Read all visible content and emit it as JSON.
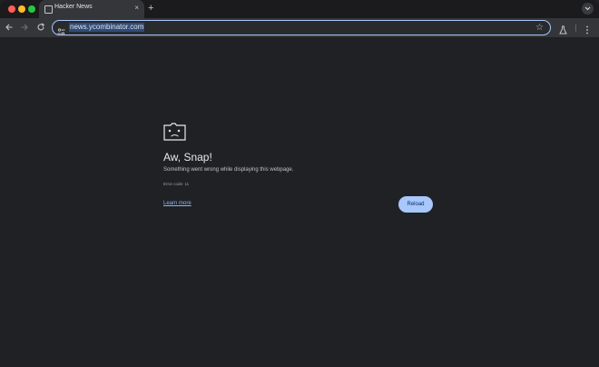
{
  "browser": {
    "tab": {
      "title": "Hacker News",
      "close_glyph": "×",
      "favicon": "page-icon"
    },
    "new_tab_glyph": "+",
    "address_bar": {
      "url": "news.ycombinator.com",
      "bookmark_glyph": "☆"
    },
    "icons": [
      "back-icon",
      "forward-icon",
      "reload-icon",
      "site-info-icon",
      "labs-icon",
      "menu-icon",
      "tab-search-icon"
    ]
  },
  "error_page": {
    "heading": "Aw, Snap!",
    "message": "Something went wrong while displaying this webpage.",
    "error_code": "Error code: 11",
    "learn_more": "Learn more",
    "reload_label": "Reload"
  },
  "colors": {
    "background": "#202124",
    "accent": "#a8c7fa",
    "link": "#8ab4f8"
  }
}
